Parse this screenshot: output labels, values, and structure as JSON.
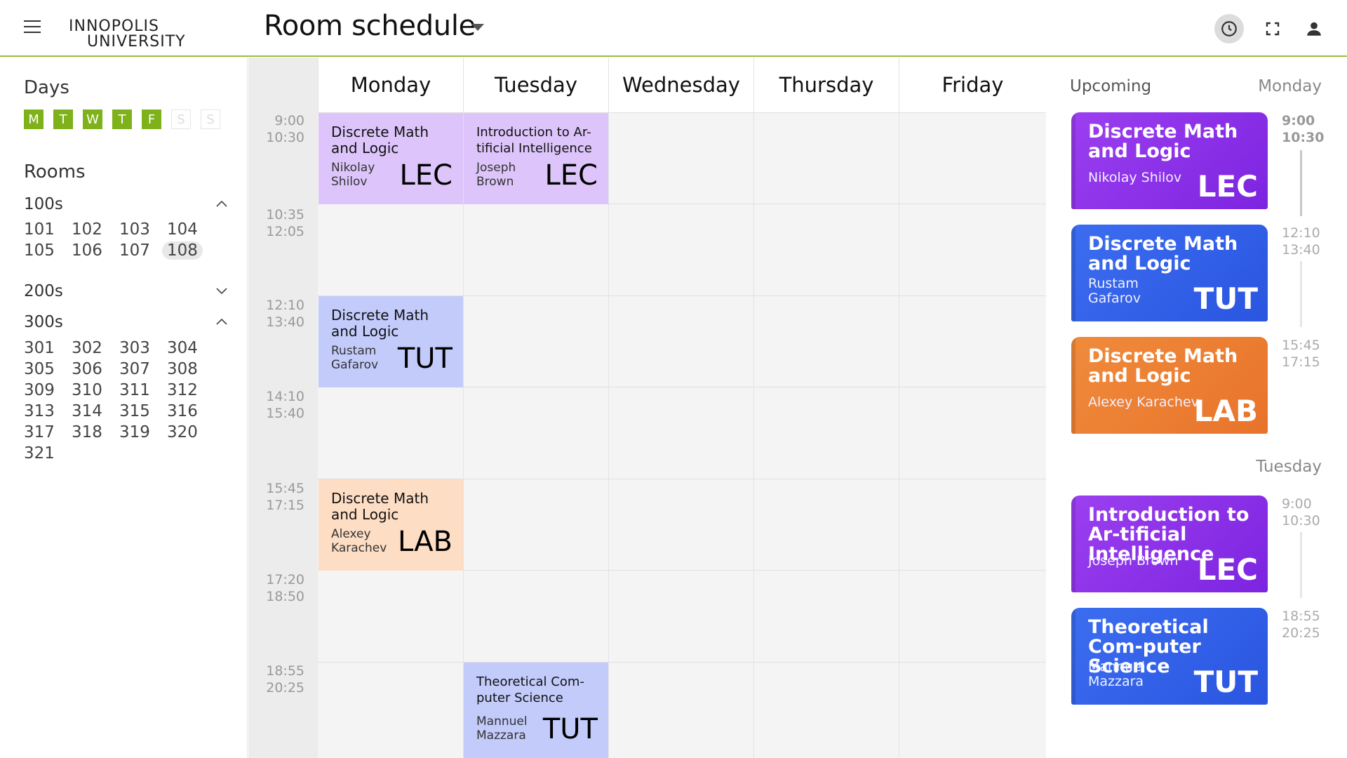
{
  "header": {
    "title": "Room schedule",
    "logo_line1": "INNOPOLIS",
    "logo_line2": "UNIVERSITY",
    "icons": [
      "menu-icon",
      "clock-icon",
      "fullscreen-icon",
      "user-icon"
    ]
  },
  "sidebar": {
    "days_label": "Days",
    "days": [
      {
        "label": "M",
        "active": true
      },
      {
        "label": "T",
        "active": true
      },
      {
        "label": "W",
        "active": true
      },
      {
        "label": "T",
        "active": true
      },
      {
        "label": "F",
        "active": true
      },
      {
        "label": "S",
        "active": false
      },
      {
        "label": "S",
        "active": false
      }
    ],
    "rooms_label": "Rooms",
    "groups": [
      {
        "label": "100s",
        "expanded": true,
        "rooms": [
          "101",
          "102",
          "103",
          "104",
          "105",
          "106",
          "107",
          "108"
        ],
        "selected": "108"
      },
      {
        "label": "200s",
        "expanded": false,
        "rooms": []
      },
      {
        "label": "300s",
        "expanded": true,
        "rooms": [
          "301",
          "302",
          "303",
          "304",
          "305",
          "306",
          "307",
          "308",
          "309",
          "310",
          "311",
          "312",
          "313",
          "314",
          "315",
          "316",
          "317",
          "318",
          "319",
          "320",
          "321"
        ]
      }
    ]
  },
  "schedule": {
    "days": [
      "Monday",
      "Tuesday",
      "Wednesday",
      "Thursday",
      "Friday"
    ],
    "slots": [
      {
        "start": "9:00",
        "end": "10:30"
      },
      {
        "start": "10:35",
        "end": "12:05"
      },
      {
        "start": "12:10",
        "end": "13:40"
      },
      {
        "start": "14:10",
        "end": "15:40"
      },
      {
        "start": "15:45",
        "end": "17:15"
      },
      {
        "start": "17:20",
        "end": "18:50"
      },
      {
        "start": "18:55",
        "end": "20:25"
      }
    ],
    "events": [
      {
        "title": "Discrete Math and Logic",
        "teacher": "Nikolay Shilov",
        "type": "LEC"
      },
      {
        "title": "Introduction to Ar-tificial Intelligence",
        "teacher": "Joseph Brown",
        "type": "LEC"
      },
      {
        "title": "Discrete Math and Logic",
        "teacher": "Rustam Gafarov",
        "type": "TUT"
      },
      {
        "title": "Discrete Math and Logic",
        "teacher": "Alexey Karachev",
        "type": "LAB"
      },
      {
        "title": "Theoretical Com-puter Science",
        "teacher": "Mannuel Mazzara",
        "type": "TUT"
      }
    ]
  },
  "upcoming": {
    "label": "Upcoming",
    "groups": [
      {
        "day": "Monday",
        "items": [
          {
            "title": "Discrete Math and Logic",
            "teacher": "Nikolay Shilov",
            "type": "LEC",
            "start": "9:00",
            "end": "10:30"
          },
          {
            "title": "Discrete Math and Logic",
            "teacher": "Rustam Gafarov",
            "type": "TUT",
            "start": "12:10",
            "end": "13:40"
          },
          {
            "title": "Discrete Math and Logic",
            "teacher": "Alexey Karachev",
            "type": "LAB",
            "start": "15:45",
            "end": "17:15"
          }
        ]
      },
      {
        "day": "Tuesday",
        "items": [
          {
            "title": "Introduction to Ar-tificial Intelligence",
            "teacher": "Joseph Brown",
            "type": "LEC",
            "start": "9:00",
            "end": "10:30"
          },
          {
            "title": "Theoretical Com-puter Science",
            "teacher": "Mannuel Mazzara",
            "type": "TUT",
            "start": "18:55",
            "end": "20:25"
          }
        ]
      }
    ]
  },
  "colors": {
    "accent_green": "#7fb21a",
    "header_line": "#9bbd3c",
    "lec_purple": "#8a2be2",
    "tut_blue": "#2f5ee8",
    "lab_orange": "#ec7d32"
  }
}
